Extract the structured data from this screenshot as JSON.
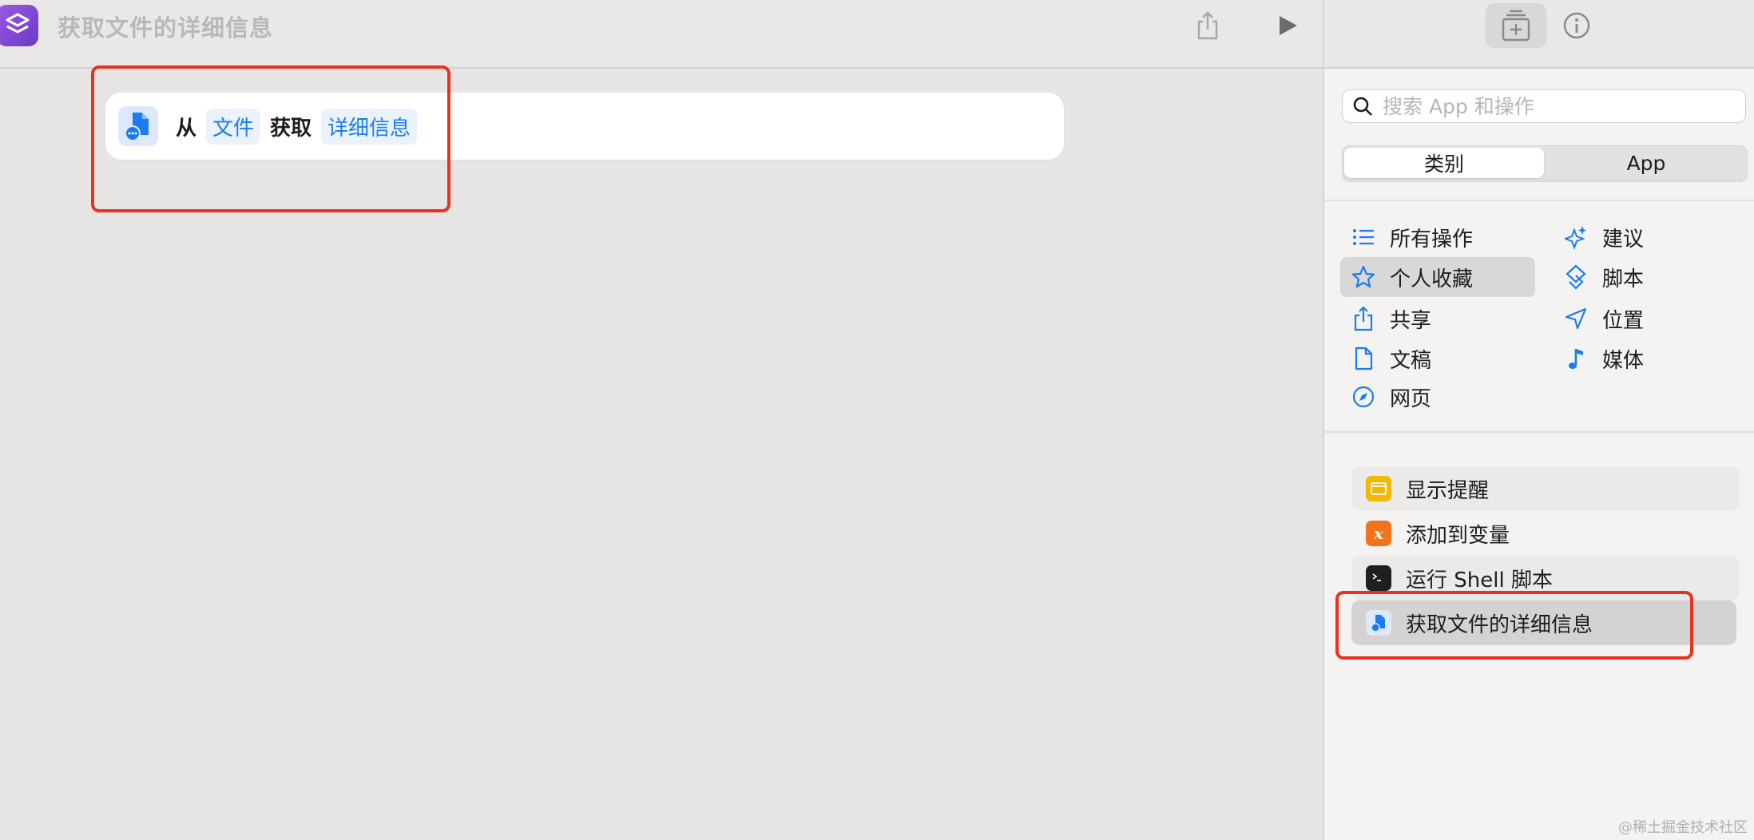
{
  "window": {
    "title": "获取文件的详细信息"
  },
  "action_card": {
    "from": "从",
    "file_token": "文件",
    "get": "获取",
    "detail_token": "详细信息"
  },
  "sidebar": {
    "search_placeholder": "搜索 App 和操作",
    "segments": {
      "category": "类别",
      "app": "App"
    },
    "categories": [
      {
        "label": "所有操作",
        "icon": "list-icon"
      },
      {
        "label": "建议",
        "icon": "sparkles-icon"
      },
      {
        "label": "个人收藏",
        "icon": "star-icon"
      },
      {
        "label": "脚本",
        "icon": "script-icon"
      },
      {
        "label": "共享",
        "icon": "share-icon"
      },
      {
        "label": "位置",
        "icon": "location-arrow-icon"
      },
      {
        "label": "文稿",
        "icon": "document-icon"
      },
      {
        "label": "媒体",
        "icon": "music-note-icon"
      },
      {
        "label": "网页",
        "icon": "compass-icon"
      }
    ],
    "actions": [
      {
        "label": "显示提醒",
        "icon": "alert-window-icon",
        "color": "#f5b700"
      },
      {
        "label": "添加到变量",
        "icon": "variable-x-icon",
        "color": "#f2731c"
      },
      {
        "label": "运行 Shell 脚本",
        "icon": "terminal-icon",
        "color": "#1f1f1f"
      },
      {
        "label": "获取文件的详细信息",
        "icon": "file-details-icon",
        "color": "#1a7cf0"
      }
    ]
  },
  "watermark": "@稀土掘金技术社区"
}
